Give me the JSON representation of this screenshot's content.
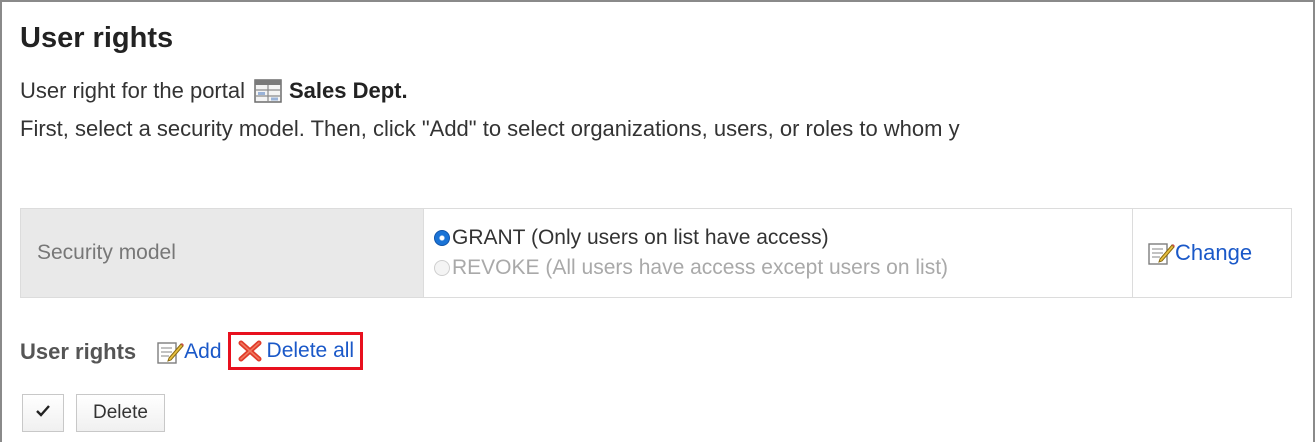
{
  "page": {
    "title": "User rights"
  },
  "portal": {
    "prefix": "User right for the portal",
    "icon": "portal-grid-icon",
    "name": "Sales Dept."
  },
  "instruction": "First, select a security model. Then, click \"Add\" to select organizations, users, or roles to whom y",
  "security_model": {
    "label": "Security model",
    "options": [
      {
        "label": "GRANT (Only users on list have access)",
        "selected": true
      },
      {
        "label": "REVOKE (All users have access except users on list)",
        "selected": false
      }
    ],
    "change_label": "Change",
    "change_icon": "edit-icon"
  },
  "rights": {
    "label": "User rights",
    "add_label": "Add",
    "add_icon": "edit-icon",
    "delete_all_label": "Delete all",
    "delete_all_icon": "red-x-icon",
    "highlight_color": "#e8101e"
  },
  "toolbar": {
    "check_icon": "checkmark-icon",
    "delete_label": "Delete"
  },
  "colors": {
    "link": "#1a58c8",
    "label_cell_bg": "#e9e9e9",
    "radio_selected": "#1a73d6"
  }
}
